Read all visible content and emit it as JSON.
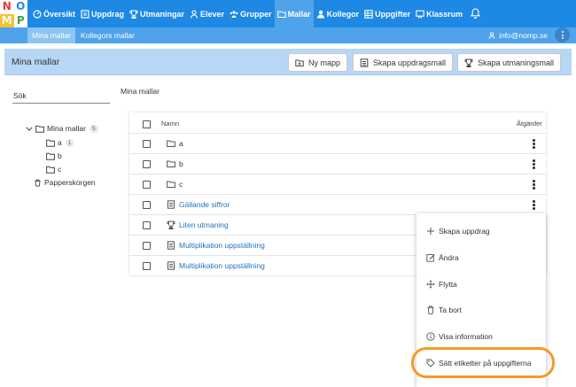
{
  "logo": {
    "letters": [
      "N",
      "O",
      "M",
      "P"
    ],
    "colors": [
      "#e53935",
      "#1e88e5",
      "#43a047",
      "#fbc02d"
    ]
  },
  "nav": {
    "items": [
      {
        "label": "Översikt",
        "icon": "gauge-icon"
      },
      {
        "label": "Uppdrag",
        "icon": "list-icon"
      },
      {
        "label": "Utmaningar",
        "icon": "trophy-icon"
      },
      {
        "label": "Elever",
        "icon": "user-icon"
      },
      {
        "label": "Grupper",
        "icon": "users-icon"
      },
      {
        "label": "Mallar",
        "icon": "folder-icon",
        "active": true
      },
      {
        "label": "Kollegor",
        "icon": "user-icon"
      },
      {
        "label": "Uppgifter",
        "icon": "grid-icon"
      },
      {
        "label": "Klassrum",
        "icon": "board-icon"
      }
    ]
  },
  "subnav": {
    "mine": "Mina mallar",
    "colleagues": "Kollegors mallar",
    "user": "info@nomp.se"
  },
  "header": {
    "title": "Mina mallar",
    "buttons": {
      "new_folder": "Ny mapp",
      "new_assignment": "Skapa uppdragsmall",
      "new_challenge": "Skapa utmaningsmall"
    }
  },
  "sidebar": {
    "search_label": "Sök",
    "root": {
      "label": "Mina mallar",
      "count": "5"
    },
    "folders": [
      {
        "label": "a",
        "count": "1"
      },
      {
        "label": "b"
      },
      {
        "label": "c"
      }
    ],
    "trash": "Papperskorgen"
  },
  "main": {
    "breadcrumb": "Mina mallar",
    "columns": {
      "name": "Namn",
      "actions": "Åtgärder"
    },
    "rows": [
      {
        "name": "a",
        "type": "folder"
      },
      {
        "name": "b",
        "type": "folder"
      },
      {
        "name": "c",
        "type": "folder"
      },
      {
        "name": "Gällande siffror",
        "type": "assignment"
      },
      {
        "name": "Liten utmaning",
        "type": "challenge"
      },
      {
        "name": "Multiplikation uppställning",
        "type": "assignment"
      },
      {
        "name": "Multiplikation uppställning",
        "type": "assignment"
      }
    ]
  },
  "menu": {
    "items": [
      {
        "label": "Skapa uppdrag",
        "icon": "plus-icon"
      },
      {
        "label": "Ändra",
        "icon": "edit-icon"
      },
      {
        "label": "Flytta",
        "icon": "move-icon"
      },
      {
        "label": "Ta bort",
        "icon": "trash-icon"
      },
      {
        "label": "Visa information",
        "icon": "info-icon"
      },
      {
        "label": "Sätt etiketter på uppgifterna",
        "icon": "tag-icon"
      }
    ],
    "highlight_color": "#f59a23"
  }
}
